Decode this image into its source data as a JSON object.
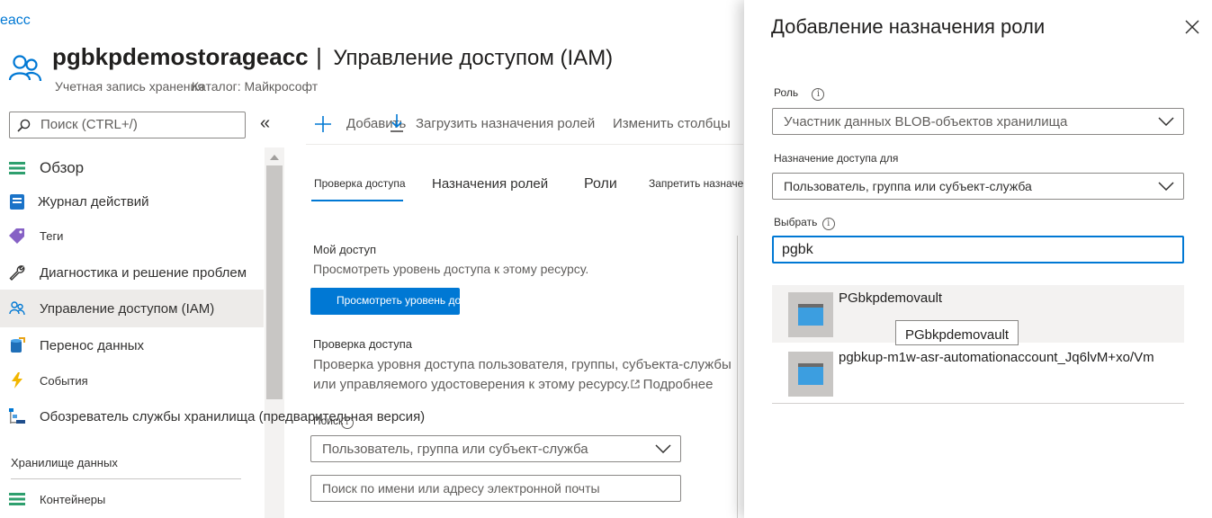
{
  "breadcrumb_tail": "eacc",
  "resource": {
    "name": "pgbkpdemostorageacc",
    "separator": "|",
    "page": "Управление доступом (IAM)",
    "subtitle": "Учетная запись хранения",
    "directory": "Каталог: Майкрософт"
  },
  "search": {
    "placeholder": "Поиск (CTRL+/)"
  },
  "collapse_glyph": "«",
  "sidebar": {
    "items": [
      {
        "label": "Обзор",
        "icon": "overview-icon"
      },
      {
        "label": "Журнал действий",
        "icon": "activity-log-icon"
      },
      {
        "label": "Теги",
        "icon": "tag-icon"
      },
      {
        "label": "Диагностика и решение проблем",
        "icon": "wrench-icon"
      },
      {
        "label": "Управление доступом (IAM)",
        "icon": "people-icon"
      },
      {
        "label": "Перенос данных",
        "icon": "data-transfer-icon"
      },
      {
        "label": "События",
        "icon": "lightning-icon"
      },
      {
        "label": "Обозреватель службы хранилища (предварительная версия)",
        "icon": "storage-explorer-icon"
      }
    ],
    "section_title": "Хранилище данных",
    "section_items": [
      {
        "label": "Контейнеры",
        "icon": "containers-icon"
      }
    ]
  },
  "toolbar": {
    "add": "Добавить",
    "download": "Загрузить назначения ролей",
    "edit_columns": "Изменить столбцы"
  },
  "tabs": [
    {
      "label": "Проверка доступа"
    },
    {
      "label": "Назначения ролей"
    },
    {
      "label": "Роли"
    },
    {
      "label": "Запретить назначения"
    }
  ],
  "my_access": {
    "title": "Мой доступ",
    "description": "Просмотреть уровень доступа к этому ресурсу.",
    "button": "Просмотреть уровень доступа"
  },
  "check_access": {
    "title": "Проверка доступа",
    "description_line1": "Проверка уровня доступа пользователя, группы, субъекта-службы",
    "description_line2": "или управляемого удостоверения к этому ресурсу.",
    "learn_more": "Подробнее",
    "find_label": "Поиск",
    "find_value": "Пользователь, группа или субъект-служба",
    "search_placeholder": "Поиск по имени или адресу электронной почты"
  },
  "panel": {
    "title": "Добавление назначения роли",
    "role_label": "Роль",
    "role_value": "Участник данных BLOB-объектов хранилища",
    "assign_label": "Назначение доступа для",
    "assign_value": "Пользователь, группа или субъект-служба",
    "select_label": "Выбрать",
    "select_value": "pgbk",
    "results": [
      {
        "name": "PGbkpdemovault"
      },
      {
        "name": "pgbkup-m1w-asr-automationaccount_Jq6lvM+xo/Vm"
      }
    ],
    "tooltip": "PGbkpdemovault"
  },
  "colors": {
    "accent": "#0078d4",
    "link": "#0078d4",
    "selected_bg": "#edebe9",
    "result_hover_bg": "#f3f2f1"
  }
}
